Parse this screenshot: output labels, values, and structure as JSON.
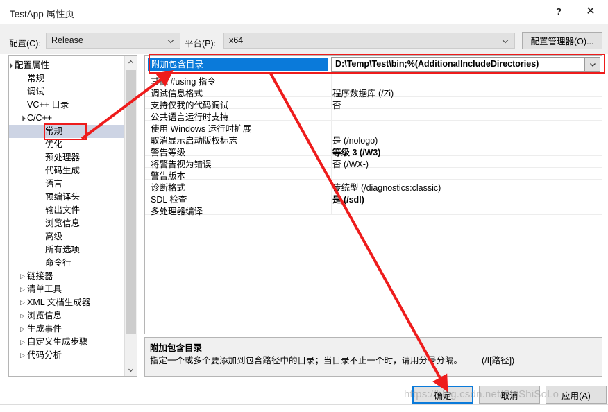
{
  "window": {
    "title": "TestApp 属性页",
    "help_icon": "question-mark-icon",
    "close_icon": "close-icon"
  },
  "config_bar": {
    "configuration_label": "配置(C):",
    "configuration_value": "Release",
    "platform_label": "平台(P):",
    "platform_value": "x64",
    "config_manager_button": "配置管理器(O)..."
  },
  "tree": {
    "items": [
      {
        "label": "配置属性",
        "indent": 0,
        "marker": "expanded",
        "selected": false
      },
      {
        "label": "常规",
        "indent": 1,
        "marker": "none",
        "selected": false
      },
      {
        "label": "调试",
        "indent": 1,
        "marker": "none",
        "selected": false
      },
      {
        "label": "VC++ 目录",
        "indent": 1,
        "marker": "none",
        "selected": false
      },
      {
        "label": "C/C++",
        "indent": 1,
        "marker": "expanded",
        "selected": false
      },
      {
        "label": "常规",
        "indent": 2,
        "marker": "none",
        "selected": true
      },
      {
        "label": "优化",
        "indent": 2,
        "marker": "none",
        "selected": false
      },
      {
        "label": "预处理器",
        "indent": 2,
        "marker": "none",
        "selected": false
      },
      {
        "label": "代码生成",
        "indent": 2,
        "marker": "none",
        "selected": false
      },
      {
        "label": "语言",
        "indent": 2,
        "marker": "none",
        "selected": false
      },
      {
        "label": "预编译头",
        "indent": 2,
        "marker": "none",
        "selected": false
      },
      {
        "label": "输出文件",
        "indent": 2,
        "marker": "none",
        "selected": false
      },
      {
        "label": "浏览信息",
        "indent": 2,
        "marker": "none",
        "selected": false
      },
      {
        "label": "高级",
        "indent": 2,
        "marker": "none",
        "selected": false
      },
      {
        "label": "所有选项",
        "indent": 2,
        "marker": "none",
        "selected": false
      },
      {
        "label": "命令行",
        "indent": 2,
        "marker": "none",
        "selected": false
      },
      {
        "label": "链接器",
        "indent": 1,
        "marker": "collapsed",
        "selected": false
      },
      {
        "label": "清单工具",
        "indent": 1,
        "marker": "collapsed",
        "selected": false
      },
      {
        "label": "XML 文档生成器",
        "indent": 1,
        "marker": "collapsed",
        "selected": false
      },
      {
        "label": "浏览信息",
        "indent": 1,
        "marker": "collapsed",
        "selected": false
      },
      {
        "label": "生成事件",
        "indent": 1,
        "marker": "collapsed",
        "selected": false
      },
      {
        "label": "自定义生成步骤",
        "indent": 1,
        "marker": "collapsed",
        "selected": false
      },
      {
        "label": "代码分析",
        "indent": 1,
        "marker": "collapsed",
        "selected": false
      }
    ]
  },
  "grid": {
    "selected_row": {
      "name": "附加包含目录",
      "value": "D:\\Temp\\Test\\bin;%(AdditionalIncludeDirectories)",
      "dropdown_icon": "chevron-down-icon"
    },
    "rows": [
      {
        "name": "其他 #using 指令",
        "value": "",
        "bold": false
      },
      {
        "name": "调试信息格式",
        "value": "程序数据库 (/Zi)",
        "bold": false
      },
      {
        "name": "支持仅我的代码调试",
        "value": "否",
        "bold": false
      },
      {
        "name": "公共语言运行时支持",
        "value": "",
        "bold": false
      },
      {
        "name": "使用 Windows 运行时扩展",
        "value": "",
        "bold": false
      },
      {
        "name": "取消显示启动版权标志",
        "value": "是 (/nologo)",
        "bold": false
      },
      {
        "name": "警告等级",
        "value": "等级 3 (/W3)",
        "bold": true
      },
      {
        "name": "将警告视为错误",
        "value": "否 (/WX-)",
        "bold": false
      },
      {
        "name": "警告版本",
        "value": "",
        "bold": false
      },
      {
        "name": "诊断格式",
        "value": "传统型 (/diagnostics:classic)",
        "bold": false
      },
      {
        "name": "SDL 检查",
        "value": "是 (/sdl)",
        "bold": true
      },
      {
        "name": "多处理器编译",
        "value": "",
        "bold": false
      }
    ]
  },
  "description": {
    "title": "附加包含目录",
    "body": "指定一个或多个要添加到包含路径中的目录；当目录不止一个时，请用分号分隔。",
    "switch": "(/I[路径])"
  },
  "footer": {
    "ok": "确定",
    "cancel": "取消",
    "apply": "应用(A)"
  },
  "watermark": "https://blog.csdn.net/ShiShiSoLo",
  "colors": {
    "selection_blue": "#0a7ada",
    "annotation_red": "#ee1c1c",
    "tree_selection": "#cdd4e4"
  }
}
